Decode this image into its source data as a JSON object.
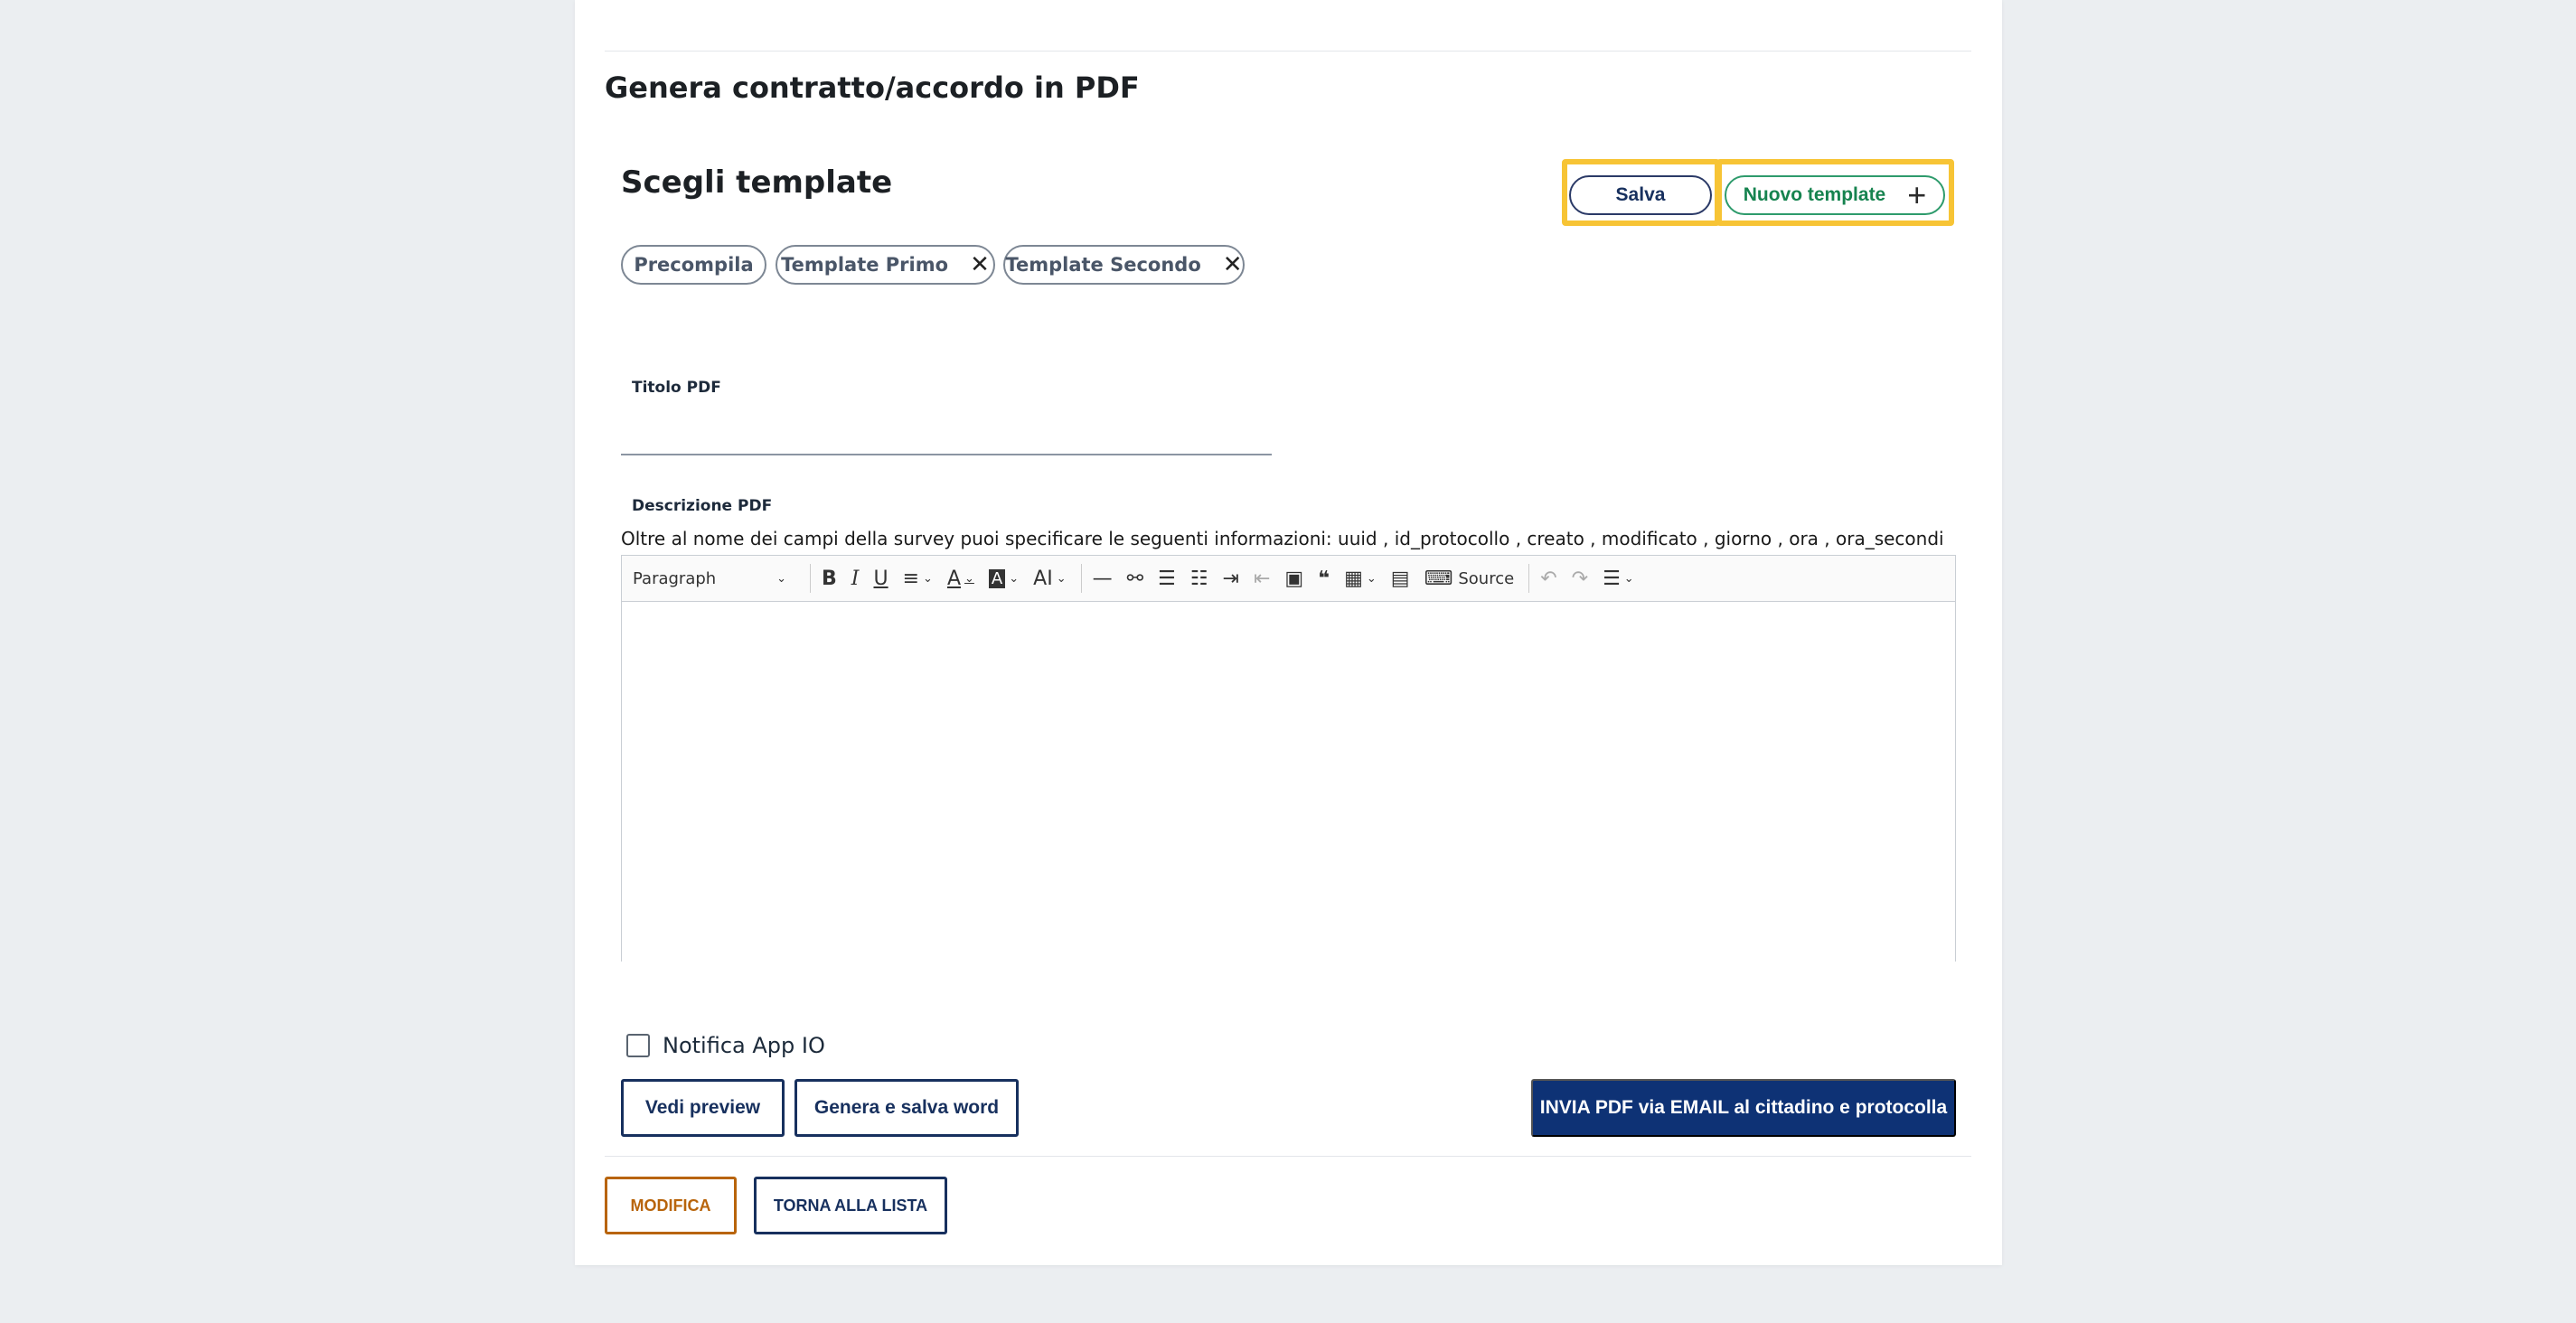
{
  "section": {
    "title": "Genera contratto/accordo in PDF"
  },
  "templates": {
    "title": "Scegli template",
    "save_label": "Salva",
    "new_label": "Nuovo template",
    "new_icon": "plus-icon",
    "chips": [
      {
        "label": "Precompila"
      },
      {
        "label": "Template Primo",
        "icon": "close-icon"
      },
      {
        "label": "Template Secondo",
        "icon": "close-icon"
      }
    ],
    "highlight_color": "#f7c435"
  },
  "form": {
    "title_label": "Titolo PDF",
    "title_value": "",
    "description_label": "Descrizione PDF",
    "helper_text": "Oltre al nome dei campi della survey puoi specificare le seguenti informazioni: uuid , id_protocollo , creato , modificato , giorno , ora , ora_secondi",
    "editor": {
      "paragraph_select": "Paragraph",
      "source_label": "Source",
      "content": ""
    },
    "notify_label": "Notifica App IO",
    "notify_checked": false
  },
  "actions": {
    "preview_label": "Vedi preview",
    "save_word_label": "Genera e salva word",
    "send_label": "INVIA PDF via EMAIL al cittadino e protocolla",
    "modify_label": "MODIFICA",
    "back_label": "TORNA ALLA LISTA"
  },
  "colors": {
    "primary": "#0e3275",
    "success": "#16834f",
    "warning": "#b8640b"
  }
}
